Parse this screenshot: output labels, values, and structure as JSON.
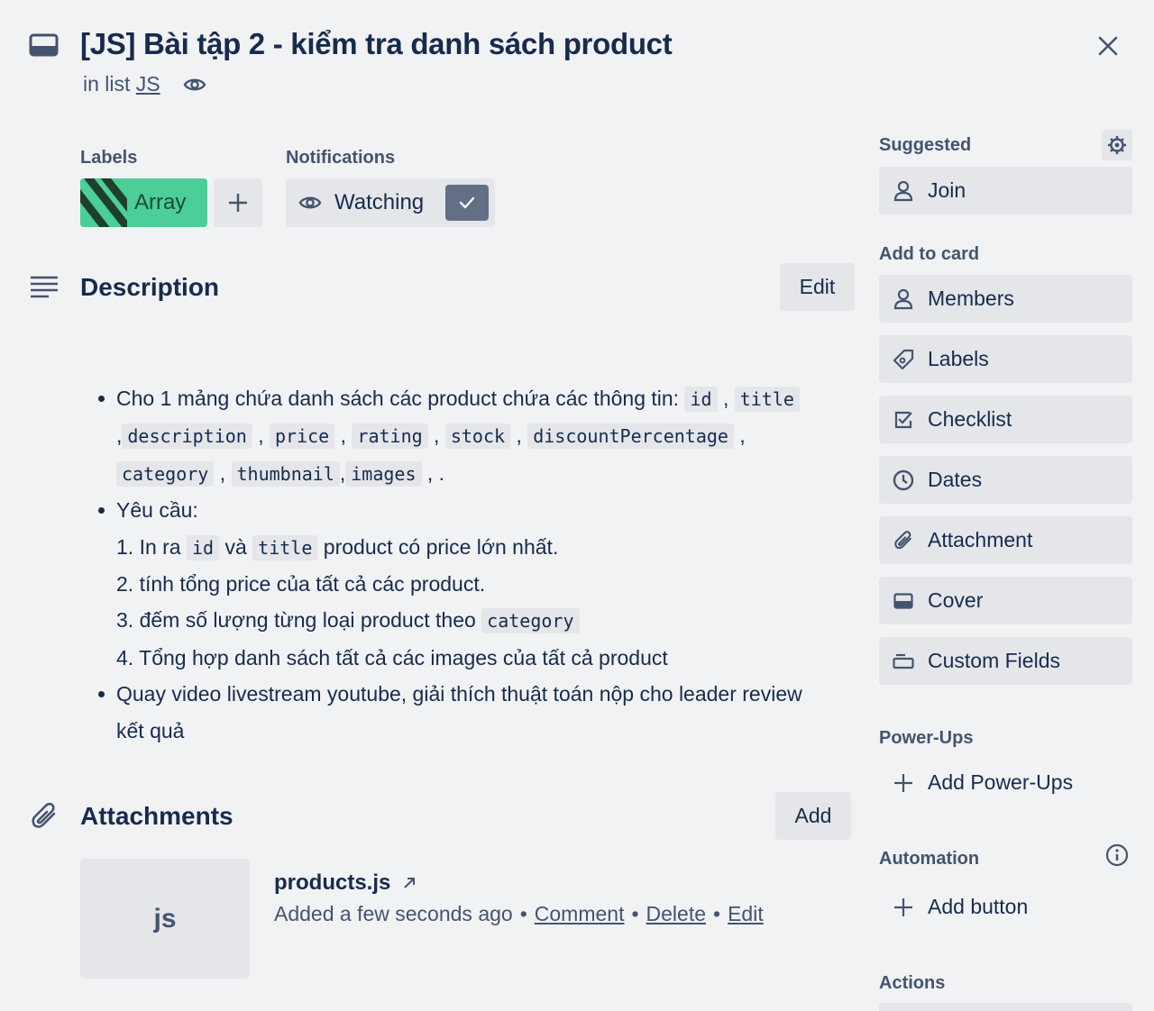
{
  "header": {
    "title": "[JS] Bài tập 2 - kiểm tra danh sách product",
    "in_list_prefix": "in list",
    "list_name": "JS"
  },
  "labels_section": {
    "heading": "Labels",
    "label_name": "Array",
    "label_color": "#4bce97"
  },
  "notifications": {
    "heading": "Notifications",
    "watch_label": "Watching"
  },
  "description": {
    "heading": "Description",
    "edit_label": "Edit",
    "bullet1_text": "Cho 1 mảng chứa danh sách các product chứa các thông tin:",
    "fields": [
      "id",
      "title",
      "description",
      "price",
      "rating",
      "stock",
      "discountPercentage",
      "category",
      "thumbnail",
      "images"
    ],
    "sep": ",",
    "end": ", .",
    "bullet2_text": "Yêu cầu:",
    "req1_pre": "1. In ra",
    "req1_and": "và",
    "req1_post": "product có price lớn nhất.",
    "req2": "2. tính tổng price của tất cả các product.",
    "req3_pre": "3. đếm số lượng từng loại product theo",
    "req4": "4. Tổng hợp danh sách tất cả các images của tất cả product",
    "bullet3_line1": "Quay video livestream youtube, giải thích thuật toán nộp cho leader review",
    "bullet3_line2": "kết quả"
  },
  "attachments": {
    "heading": "Attachments",
    "add_label": "Add",
    "thumb_text": "js",
    "file_name": "products.js",
    "added_text": "Added a few seconds ago",
    "bullet": "•",
    "comment": "Comment",
    "delete": "Delete",
    "edit": "Edit"
  },
  "sidebar": {
    "suggested": "Suggested",
    "join": "Join",
    "add_to_card": "Add to card",
    "buttons": [
      "Members",
      "Labels",
      "Checklist",
      "Dates",
      "Attachment",
      "Cover",
      "Custom Fields"
    ],
    "power_ups": "Power-Ups",
    "add_power_ups": "Add Power-Ups",
    "automation": "Automation",
    "add_button": "Add button",
    "actions": "Actions"
  }
}
